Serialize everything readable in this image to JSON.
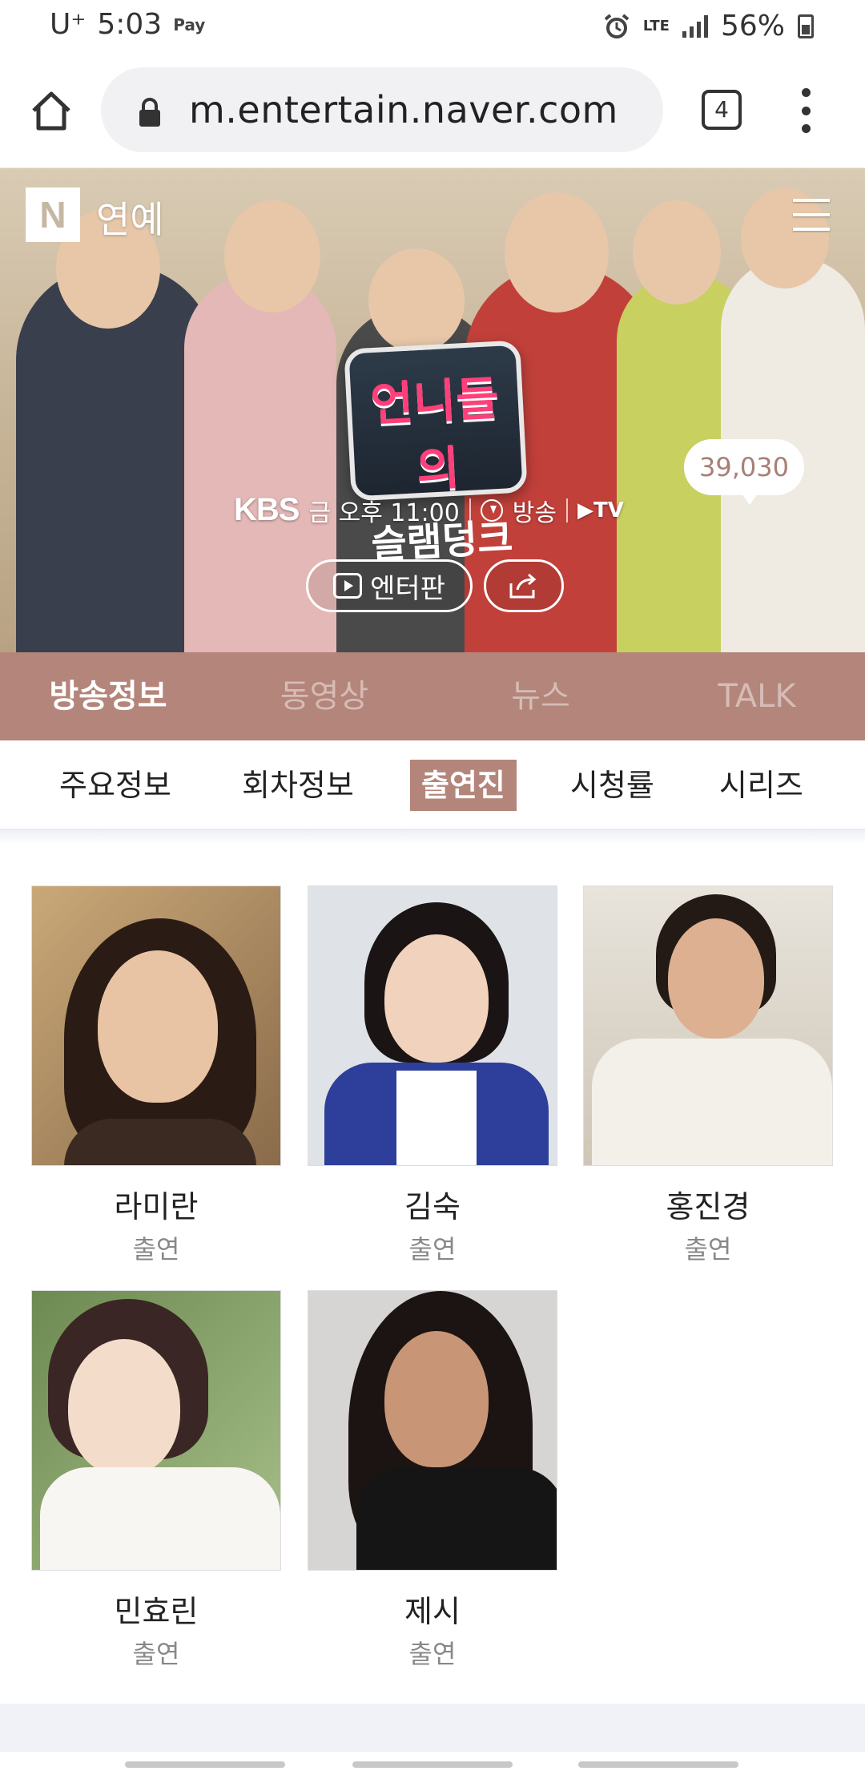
{
  "status_bar": {
    "carrier": "U⁺",
    "time": "5:03",
    "pay_label": "Pay",
    "network": "LTE",
    "battery": "56%"
  },
  "browser": {
    "url": "m.entertain.naver.com",
    "tab_count": "4"
  },
  "hero": {
    "logo_letter": "N",
    "section": "연예",
    "show_logo_line1": "언니들의",
    "show_logo_line2": "슬램덩크",
    "network": "KBS",
    "schedule": "금 오후 11:00",
    "broadcast_label": "방송",
    "tv_label": "TV",
    "entertain_button": "엔터판",
    "talk_count": "39,030"
  },
  "main_tabs": [
    {
      "label": "방송정보",
      "active": true
    },
    {
      "label": "동영상",
      "active": false
    },
    {
      "label": "뉴스",
      "active": false
    },
    {
      "label": "TALK",
      "active": false
    }
  ],
  "sub_tabs": [
    {
      "label": "주요정보",
      "active": false
    },
    {
      "label": "회차정보",
      "active": false
    },
    {
      "label": "출연진",
      "active": true
    },
    {
      "label": "시청률",
      "active": false
    },
    {
      "label": "시리즈",
      "active": false
    }
  ],
  "cast": [
    {
      "name": "라미란",
      "role": "출연"
    },
    {
      "name": "김숙",
      "role": "출연"
    },
    {
      "name": "홍진경",
      "role": "출연"
    },
    {
      "name": "민효린",
      "role": "출연"
    },
    {
      "name": "제시",
      "role": "출연"
    }
  ],
  "colors": {
    "accent": "#b4857a",
    "talk_text": "#a87f76"
  }
}
